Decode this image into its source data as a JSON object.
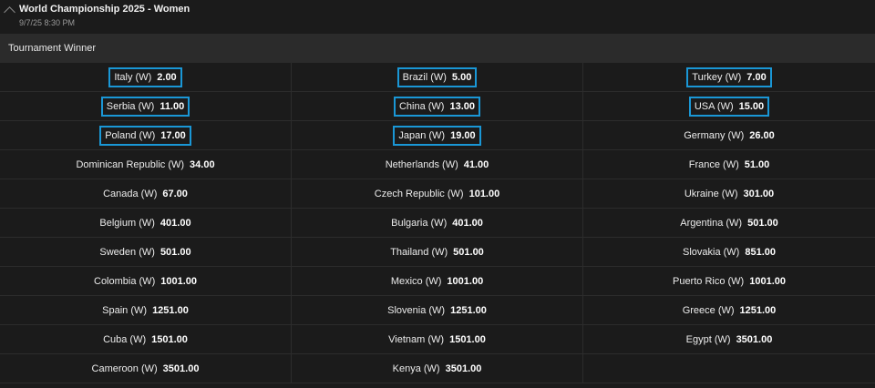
{
  "event": {
    "title": "World Championship 2025 - Women",
    "date": "9/7/25 8:30 PM"
  },
  "market": {
    "name": "Tournament Winner"
  },
  "colors": {
    "highlight": "#1a97d6",
    "background": "#1b1b1b",
    "market_bar": "#2b2b2b"
  },
  "rows": [
    [
      {
        "name": "Italy (W)",
        "odds": "2.00",
        "highlighted": true
      },
      {
        "name": "Brazil (W)",
        "odds": "5.00",
        "highlighted": true
      },
      {
        "name": "Turkey (W)",
        "odds": "7.00",
        "highlighted": true
      }
    ],
    [
      {
        "name": "Serbia (W)",
        "odds": "11.00",
        "highlighted": true
      },
      {
        "name": "China (W)",
        "odds": "13.00",
        "highlighted": true
      },
      {
        "name": "USA (W)",
        "odds": "15.00",
        "highlighted": true
      }
    ],
    [
      {
        "name": "Poland (W)",
        "odds": "17.00",
        "highlighted": true
      },
      {
        "name": "Japan (W)",
        "odds": "19.00",
        "highlighted": true
      },
      {
        "name": "Germany (W)",
        "odds": "26.00",
        "highlighted": false
      }
    ],
    [
      {
        "name": "Dominican Republic (W)",
        "odds": "34.00",
        "highlighted": false
      },
      {
        "name": "Netherlands (W)",
        "odds": "41.00",
        "highlighted": false
      },
      {
        "name": "France (W)",
        "odds": "51.00",
        "highlighted": false
      }
    ],
    [
      {
        "name": "Canada (W)",
        "odds": "67.00",
        "highlighted": false
      },
      {
        "name": "Czech Republic (W)",
        "odds": "101.00",
        "highlighted": false
      },
      {
        "name": "Ukraine (W)",
        "odds": "301.00",
        "highlighted": false
      }
    ],
    [
      {
        "name": "Belgium (W)",
        "odds": "401.00",
        "highlighted": false
      },
      {
        "name": "Bulgaria (W)",
        "odds": "401.00",
        "highlighted": false
      },
      {
        "name": "Argentina (W)",
        "odds": "501.00",
        "highlighted": false
      }
    ],
    [
      {
        "name": "Sweden (W)",
        "odds": "501.00",
        "highlighted": false
      },
      {
        "name": "Thailand (W)",
        "odds": "501.00",
        "highlighted": false
      },
      {
        "name": "Slovakia (W)",
        "odds": "851.00",
        "highlighted": false
      }
    ],
    [
      {
        "name": "Colombia (W)",
        "odds": "1001.00",
        "highlighted": false
      },
      {
        "name": "Mexico (W)",
        "odds": "1001.00",
        "highlighted": false
      },
      {
        "name": "Puerto Rico (W)",
        "odds": "1001.00",
        "highlighted": false
      }
    ],
    [
      {
        "name": "Spain (W)",
        "odds": "1251.00",
        "highlighted": false
      },
      {
        "name": "Slovenia (W)",
        "odds": "1251.00",
        "highlighted": false
      },
      {
        "name": "Greece (W)",
        "odds": "1251.00",
        "highlighted": false
      }
    ],
    [
      {
        "name": "Cuba (W)",
        "odds": "1501.00",
        "highlighted": false
      },
      {
        "name": "Vietnam (W)",
        "odds": "1501.00",
        "highlighted": false
      },
      {
        "name": "Egypt (W)",
        "odds": "3501.00",
        "highlighted": false
      }
    ],
    [
      {
        "name": "Cameroon (W)",
        "odds": "3501.00",
        "highlighted": false
      },
      {
        "name": "Kenya (W)",
        "odds": "3501.00",
        "highlighted": false
      },
      null
    ]
  ]
}
